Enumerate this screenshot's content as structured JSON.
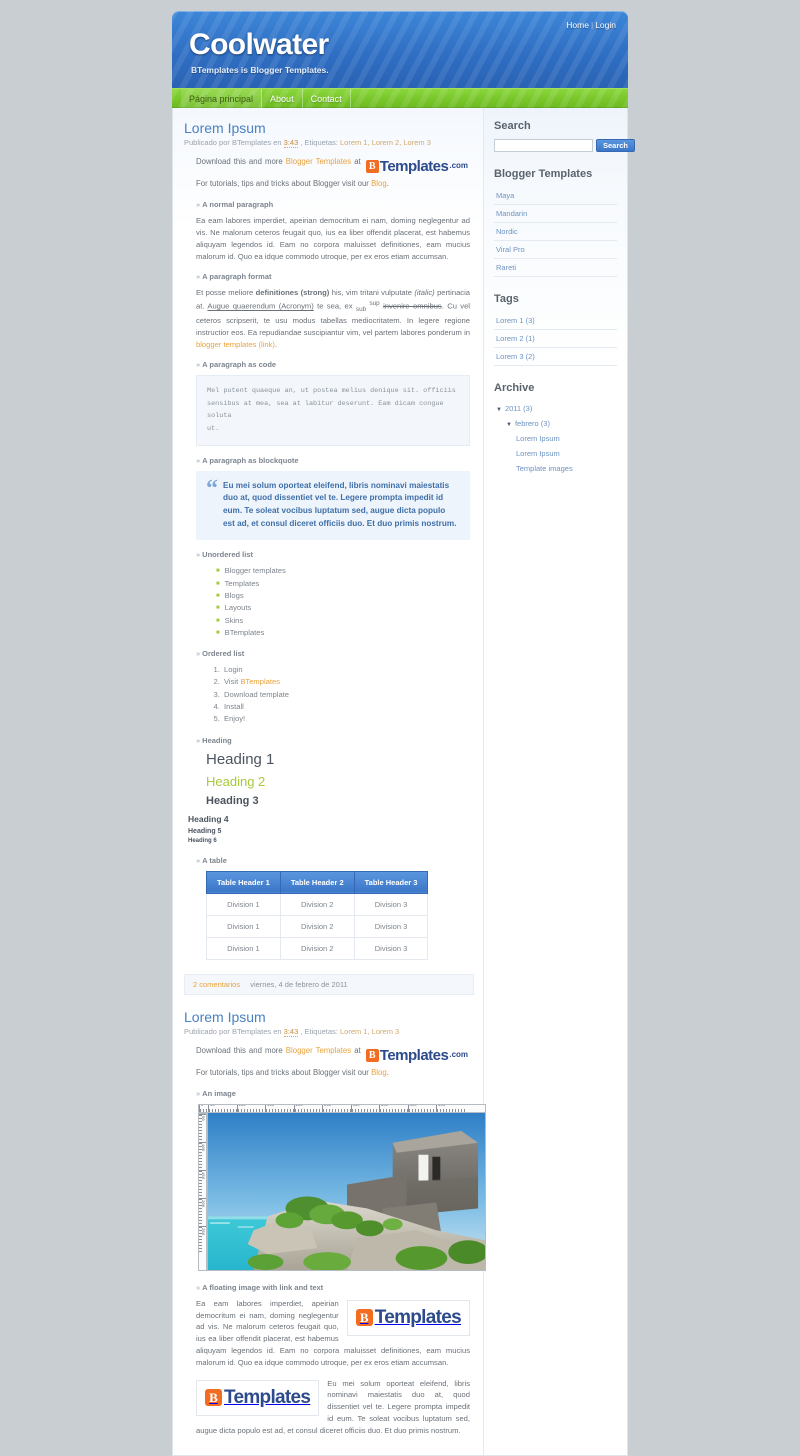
{
  "header": {
    "blog_title": "Coolwater",
    "blog_description": "BTemplates is Blogger Templates.",
    "home_link": "Home",
    "separator": "|",
    "login_link": "Login"
  },
  "nav": {
    "items": [
      {
        "label": "Página principal",
        "active": true
      },
      {
        "label": "About",
        "active": false
      },
      {
        "label": "Contact",
        "active": false
      }
    ]
  },
  "posts": [
    {
      "title": "Lorem Ipsum",
      "meta_prefix": "Publicado por BTemplates en",
      "meta_time": "3:43",
      "meta_labels_label": ", Etiquetas:",
      "meta_tags": [
        "Lorem 1",
        "Lorem 2",
        "Lorem 3"
      ],
      "lead_1": "Download this and more",
      "lead_link_1": "Blogger Templates",
      "lead_2": "at",
      "logo_b": "B",
      "logo_text": "Templates",
      "logo_com": ".com",
      "lead_3": "For tutorials, tips and tricks about Blogger visit our",
      "lead_link_2": "Blog",
      "lead_end": ".",
      "sections": {
        "normal_paragraph": "A normal paragraph",
        "paragraph_format": "A paragraph format",
        "paragraph_code": "A paragraph as code",
        "paragraph_blockquote": "A paragraph as blockquote",
        "unordered_list": "Unordered list",
        "ordered_list": "Ordered list",
        "heading": "Heading",
        "table": "A table"
      },
      "normal_text": "Ea eam labores imperdiet, apeirian democritum ei nam, doming neglegentur ad vis. Ne malorum ceteros feugait quo, ius ea liber offendit placerat, est habemus aliquyam legendos id. Eam no corpora maluisset definitiones, eam mucius malorum id. Quo ea idque commodo utroque, per ex eros etiam accumsan.",
      "format_parts": {
        "t1": "Et posse meliore ",
        "strong": "definitiones (strong)",
        "t2": " his, vim tritani vulputate ",
        "italic": "(italic)",
        "t3": " pertinacia at. ",
        "acronym": "Augue quaerendum (Acronym)",
        "t4": " te sea, ex ",
        "sub": "sub",
        "sup": "sup",
        "strike": "invenire omnibus",
        "t5": ". Cu vel ceteros scripserit, te usu modus tabellas mediocritatem. In legere regione instructior eos. Ea repudiandae suscipiantur vim, vel partem labores ponderum in ",
        "link": "blogger templates (link)",
        "t6": "."
      },
      "code_text": "Mel putent quaeque an, ut postea melius denique sit. officiis\nsensibus at mea, sea at labitur deserunt. Eam dicam congue soluta\nut.",
      "blockquote_mark": "“",
      "blockquote_text": "Eu mei solum oporteat eleifend, libris nominavi maiestatis duo at, quod dissentiet vel te. Legere prompta impedit id eum. Te soleat vocibus luptatum sed, augue dicta populo est ad, et consul diceret officiis duo. Et duo primis nostrum.",
      "ul_items": [
        "Blogger templates",
        "Templates",
        "Blogs",
        "Layouts",
        "Skins",
        "BTemplates"
      ],
      "ol_items": [
        {
          "text": "Login",
          "link": false
        },
        {
          "text": "Visit ",
          "link_text": "BTemplates",
          "link": true
        },
        {
          "text": "Download template",
          "link": false
        },
        {
          "text": "Install",
          "link": false
        },
        {
          "text": "Enjoy!",
          "link": false
        }
      ],
      "headings": [
        "Heading 1",
        "Heading 2",
        "Heading 3",
        "Heading 4",
        "Heading 5",
        "Heading 6"
      ],
      "table": {
        "headers": [
          "Table Header 1",
          "Table Header 2",
          "Table Header 3"
        ],
        "rows": [
          [
            "Division 1",
            "Division 2",
            "Division 3"
          ],
          [
            "Division 1",
            "Division 2",
            "Division 3"
          ],
          [
            "Division 1",
            "Division 2",
            "Division 3"
          ]
        ]
      },
      "footer_comments": "2 comentarios",
      "footer_date": "viernes, 4 de febrero de 2011"
    },
    {
      "title": "Lorem Ipsum",
      "meta_prefix": "Publicado por BTemplates en",
      "meta_time": "3:43",
      "meta_labels_label": ", Etiquetas:",
      "meta_tags": [
        "Lorem 1",
        "Lorem 3"
      ],
      "lead_1": "Download this and more",
      "lead_link_1": "Blogger Templates",
      "lead_2": "at",
      "lead_3": "For tutorials, tips and tricks about Blogger visit our",
      "lead_link_2": "Blog",
      "sections": {
        "an_image": "An image",
        "floating_image": "A floating image with link and text"
      },
      "ruler_top_labels": [
        "0",
        "50",
        "100",
        "150",
        "200",
        "250",
        "300",
        "350",
        "400",
        "450"
      ],
      "ruler_left_labels": [
        "50",
        "100",
        "150",
        "200",
        "250"
      ],
      "float_text_1": "Ea eam labores imperdiet, apeirian democritum ei nam, doming neglegentur ad vis. Ne malorum ceteros feugait quo, ius ea liber offendit placerat, est habemus aliquyam legendos id. Eam no corpora maluisset definitiones, eam mucius malorum id. Quo ea idque commodo utroque, per ex eros etiam accumsan.",
      "float_text_2": "Eu mei solum oporteat eleifend, libris nominavi maiestatis duo at, quod dissentiet vel te. Legere prompta impedit id eum. Te soleat vocibus luptatum sed, augue dicta populo est ad, et consul diceret officiis duo. Et duo primis nostrum."
    }
  ],
  "sidebar": {
    "search": {
      "title": "Search",
      "value": "",
      "placeholder": "",
      "button_label": "Search"
    },
    "templates": {
      "title": "Blogger Templates",
      "items": [
        "Maya",
        "Mandarin",
        "Nordic",
        "Viral Pro",
        "Rareti"
      ]
    },
    "tags": {
      "title": "Tags",
      "items": [
        "Lorem 1 (3)",
        "Lorem 2 (1)",
        "Lorem 3 (2)"
      ]
    },
    "archive": {
      "title": "Archive",
      "year": "2011 (3)",
      "month": "febrero (3)",
      "posts": [
        "Lorem Ipsum",
        "Lorem Ipsum",
        "Template images"
      ],
      "triangle": "▼"
    }
  },
  "colors": {
    "header_blue": "#2f6fc4",
    "nav_green": "#79c72b",
    "link_blue": "#6d93c0",
    "link_orange": "#e8a33d",
    "heading2_green": "#a8c93c",
    "page_bg": "#c9ced3"
  }
}
